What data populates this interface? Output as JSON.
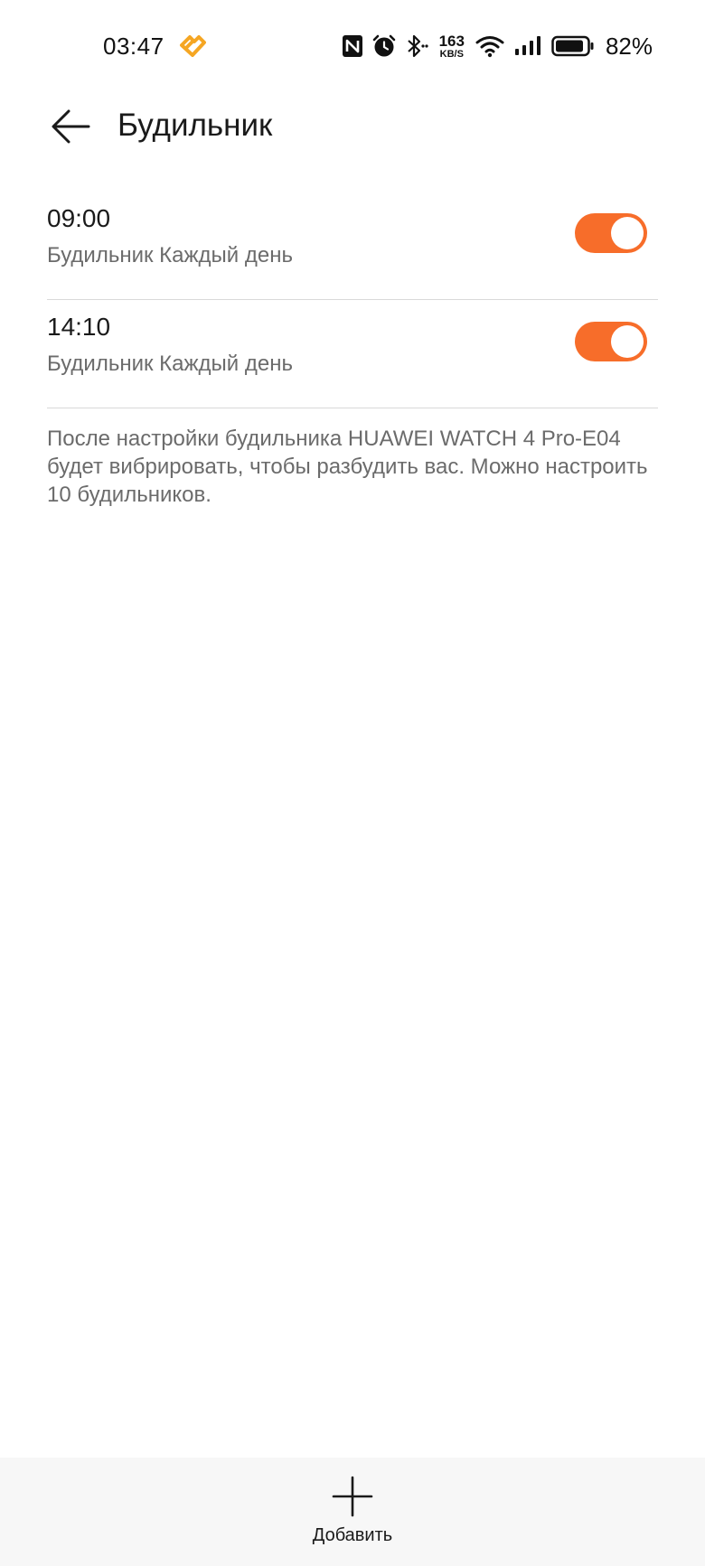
{
  "status_bar": {
    "time": "03:47",
    "speed_value": "163",
    "speed_unit": "KB/S",
    "battery_percent": "82%",
    "icons": [
      "health-icon",
      "nfc-icon",
      "alarm-icon",
      "bluetooth-icon",
      "wifi-icon",
      "signal-icon",
      "battery-icon"
    ]
  },
  "header": {
    "title": "Будильник",
    "back_icon": "back-arrow-icon"
  },
  "alarms": [
    {
      "time": "09:00",
      "description": "Будильник Каждый день",
      "enabled": true
    },
    {
      "time": "14:10",
      "description": "Будильник Каждый день",
      "enabled": true
    }
  ],
  "info": {
    "text": "После настройки будильника HUAWEI WATCH 4 Pro-E04 будет вибрировать, чтобы разбудить вас. Можно настроить 10 будильников."
  },
  "bottom_bar": {
    "add_label": "Добавить",
    "add_icon": "plus-icon"
  },
  "colors": {
    "accent": "#f76d2a",
    "health_icon": "#f5a623",
    "secondary_text": "#6b6b6b",
    "divider": "#d9d9d9",
    "bottom_bar_bg": "#f7f7f7"
  }
}
